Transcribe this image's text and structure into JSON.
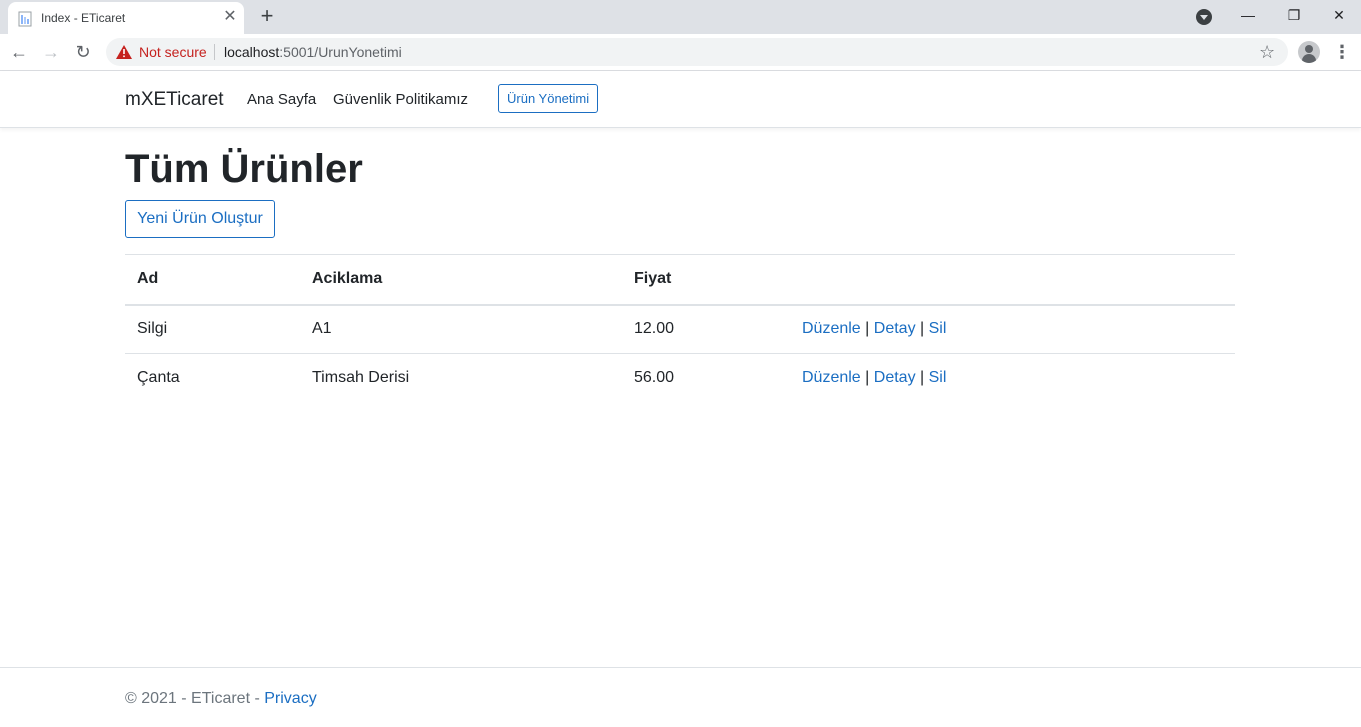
{
  "browser": {
    "tab_title": "Index - ETicaret",
    "security_label": "Not secure",
    "url_host": "localhost",
    "url_rest": ":5001/UrunYonetimi"
  },
  "navbar": {
    "brand": "mXETicaret",
    "links": [
      "Ana Sayfa",
      "Güvenlik Politikamız",
      "Ürün Yönetimi"
    ]
  },
  "main": {
    "title": "Tüm Ürünler",
    "create_button": "Yeni Ürün Oluştur",
    "table": {
      "headers": [
        "Ad",
        "Aciklama",
        "Fiyat"
      ],
      "rows": [
        {
          "ad": "Silgi",
          "aciklama": "A1",
          "fiyat": "12.00"
        },
        {
          "ad": "Çanta",
          "aciklama": "Timsah Derisi",
          "fiyat": "56.00"
        }
      ],
      "actions": {
        "edit": "Düzenle",
        "detail": "Detay",
        "delete": "Sil",
        "separator": "|"
      }
    }
  },
  "footer": {
    "copyright": "© 2021 - ETicaret - ",
    "privacy": "Privacy"
  },
  "colors": {
    "accent": "#1b6ec2",
    "warning": "#c5221f",
    "chrome_tabstrip": "#dee1e6"
  },
  "icons": [
    "document-icon",
    "close-icon",
    "plus-icon",
    "profile-dropdown-icon",
    "minimize-icon",
    "restore-icon",
    "window-close-icon",
    "back-icon",
    "forward-icon",
    "reload-icon",
    "warning-icon",
    "star-icon",
    "avatar-icon",
    "menu-dots-icon"
  ]
}
